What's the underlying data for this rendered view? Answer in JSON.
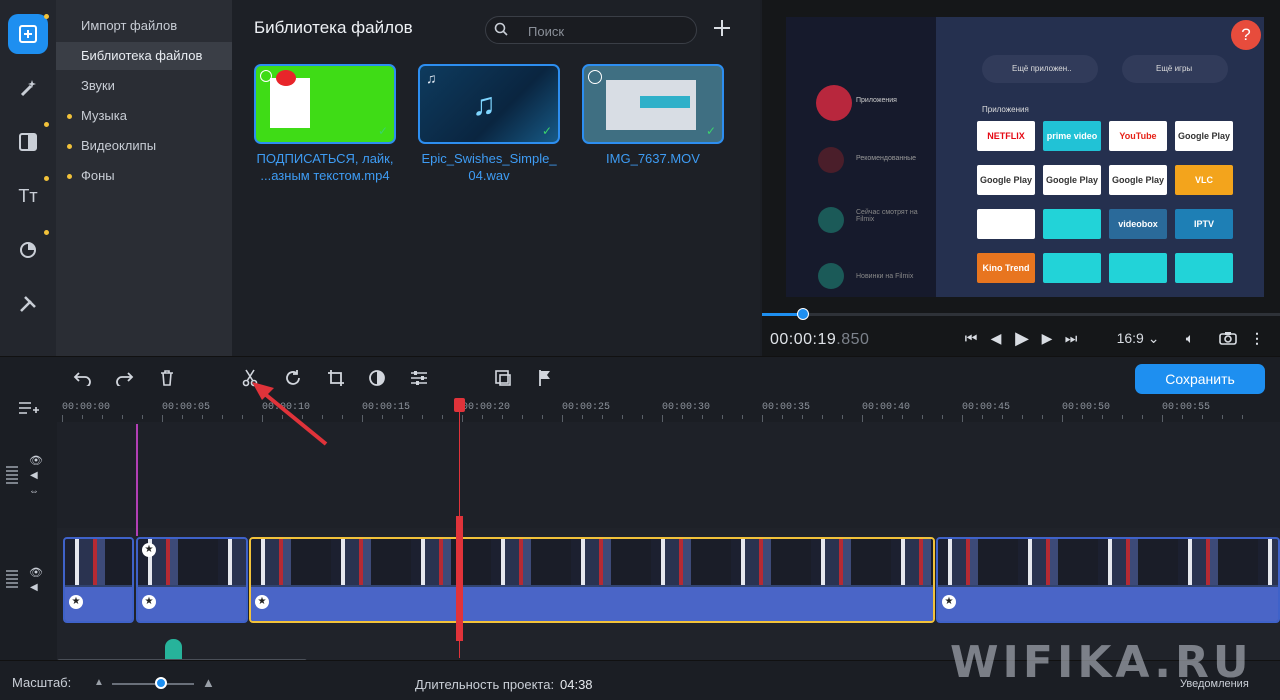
{
  "sidebar": {
    "icons": [
      "import-icon",
      "magic-wand-icon",
      "transitions-icon",
      "titles-icon",
      "stickers-icon",
      "tools-icon"
    ]
  },
  "categories": [
    {
      "label": "Импорт файлов",
      "dot": false,
      "active": false
    },
    {
      "label": "Библиотека файлов",
      "dot": false,
      "active": true
    },
    {
      "label": "Звуки",
      "dot": false,
      "active": false
    },
    {
      "label": "Музыка",
      "dot": true,
      "active": false
    },
    {
      "label": "Видеоклипы",
      "dot": true,
      "active": false
    },
    {
      "label": "Фоны",
      "dot": true,
      "active": false
    }
  ],
  "library": {
    "title": "Библиотека файлов",
    "search_placeholder": "Поиск",
    "files": [
      {
        "name_line1": "ПОДПИСАТЬСЯ, лайк,",
        "name_line2": "...азным текстом.mp4",
        "kind": "video"
      },
      {
        "name_line1": "Epic_Swishes_Simple_",
        "name_line2": "04.wav",
        "kind": "audio"
      },
      {
        "name_line1": "IMG_7637.MOV",
        "name_line2": "",
        "kind": "video"
      }
    ]
  },
  "preview": {
    "help": "?",
    "timecode_main": "00:00:19",
    "timecode_ms": ".850",
    "aspect": "16:9 ⌄",
    "progress_fraction": 0.08,
    "screen": {
      "top_buttons": [
        "Ещё приложен..",
        "Ещё игры"
      ],
      "section": "Приложения",
      "side_menu": [
        "Приложения",
        "Рекомендованные",
        "Сейчас смотрят на Filmix",
        "Новинки на Filmix"
      ],
      "apps": [
        "NETFLIX",
        "prime video",
        "YouTube",
        "Google Play",
        "Google Play",
        "Google Play",
        "Google Play",
        "VLC",
        "",
        "",
        "videobox",
        "IPTV",
        "Kino Trend",
        "",
        "",
        ""
      ]
    }
  },
  "toolbar": {
    "save_label": "Сохранить"
  },
  "timeline": {
    "ticks": [
      "00:00:00",
      "00:00:05",
      "00:00:10",
      "00:00:15",
      "00:00:20",
      "00:00:25",
      "00:00:30",
      "00:00:35",
      "00:00:40",
      "00:00:45",
      "00:00:50",
      "00:00:55"
    ],
    "playhead_time": "00:00:20"
  },
  "footer": {
    "scale_label": "Масштаб:",
    "duration_label": "Длительность проекта:",
    "duration_value": "04:38",
    "notifications": "Уведомления",
    "watermark": "WIFIKA.RU"
  },
  "colors": {
    "accent": "#1e8ff0",
    "selection": "#f2c23a",
    "playhead": "#e0333a"
  }
}
